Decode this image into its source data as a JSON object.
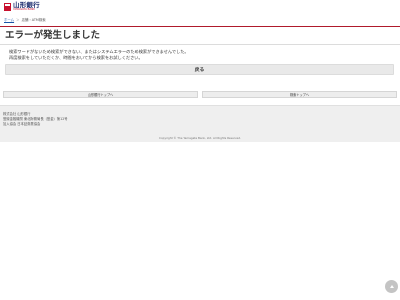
{
  "header": {
    "logo_name": "山形銀行",
    "logo_sub": "YAMAGATA BANK"
  },
  "breadcrumb": {
    "items": [
      "ホーム",
      "店舗・ATM検索"
    ],
    "separator": "＞"
  },
  "page": {
    "title": "エラーが発生しました",
    "message_line1": "検索ワードがないため検索ができない、またはシステムエラーのため検索ができませんでした。",
    "message_line2": "再度検索をしていただくか、時間をおいてから検索をお試しください。",
    "back_label": "戻る"
  },
  "nav": {
    "bank_top_label": "山形銀行トップへ",
    "search_top_label": "検索トップへ"
  },
  "footer": {
    "company": "株式会社 山形銀行",
    "registration": "登録金融機関 東北財務局長（登金）第12号",
    "association": "加入協会 日本証券業協会",
    "copyright": "Copyright © The Yamagata Bank, Ltd. All Rights Reserved."
  },
  "colors": {
    "brand_red": "#c8102e",
    "brand_navy": "#1a2a6c",
    "link_blue": "#1a55a8"
  }
}
